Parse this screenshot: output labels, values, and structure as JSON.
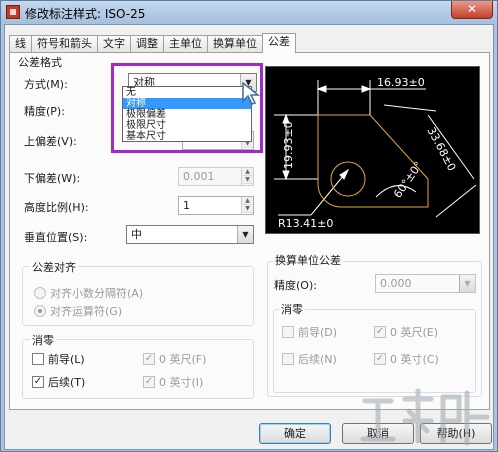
{
  "window": {
    "title": "修改标注样式: ISO-25",
    "close_glyph": "✕"
  },
  "tabs": [
    "线",
    "符号和箭头",
    "文字",
    "调整",
    "主单位",
    "换算单位",
    "公差"
  ],
  "active_tab_index": 6,
  "tolerance_format": {
    "title": "公差格式",
    "method_label": "方式(M):",
    "method_value": "对称",
    "method_options": [
      "无",
      "对称",
      "极限偏差",
      "极限尺寸",
      "基本尺寸"
    ],
    "method_selected_index": 1,
    "precision_label": "精度(P):",
    "upper_label": "上偏差(V):",
    "lower_label": "下偏差(W):",
    "lower_value": "0.001",
    "height_scale_label": "高度比例(H):",
    "height_scale_value": "1",
    "vertical_pos_label": "垂直位置(S):",
    "vertical_pos_value": "中"
  },
  "tolerance_alignment": {
    "title": "公差对齐",
    "option1": "对齐小数分隔符(A)",
    "option2": "对齐运算符(G)",
    "selected_index": 1
  },
  "zero_suppression_left": {
    "title": "消零",
    "leading": "前导(L)",
    "leading_checked": false,
    "trailing": "后续(T)",
    "trailing_checked": true,
    "feet": "0 英尺(F)",
    "feet_checked": true,
    "inches": "0 英寸(I)",
    "inches_checked": true
  },
  "alt_unit_tolerance": {
    "title": "换算单位公差",
    "precision_label": "精度(O):",
    "precision_value": "0.000",
    "zero_title": "消零",
    "leading": "前导(D)",
    "leading_checked": false,
    "trailing": "后续(N)",
    "trailing_checked": false,
    "feet": "0 英尺(E)",
    "feet_checked": true,
    "inches": "0 英寸(C)",
    "inches_checked": true
  },
  "preview": {
    "dim_top": "16.93±0",
    "dim_left": "19.93±0",
    "dim_right": "33.68±0",
    "dim_angle": "60°±0°",
    "dim_radius": "R13.41±0"
  },
  "buttons": {
    "ok": "确定",
    "cancel": "取消",
    "help": "帮助(H)"
  },
  "colors": {
    "highlight": "#a329c8",
    "selection": "#3399ff",
    "preview_bg": "#000000",
    "dim_line": "#ffffff",
    "geometry": "#e8a33a"
  }
}
